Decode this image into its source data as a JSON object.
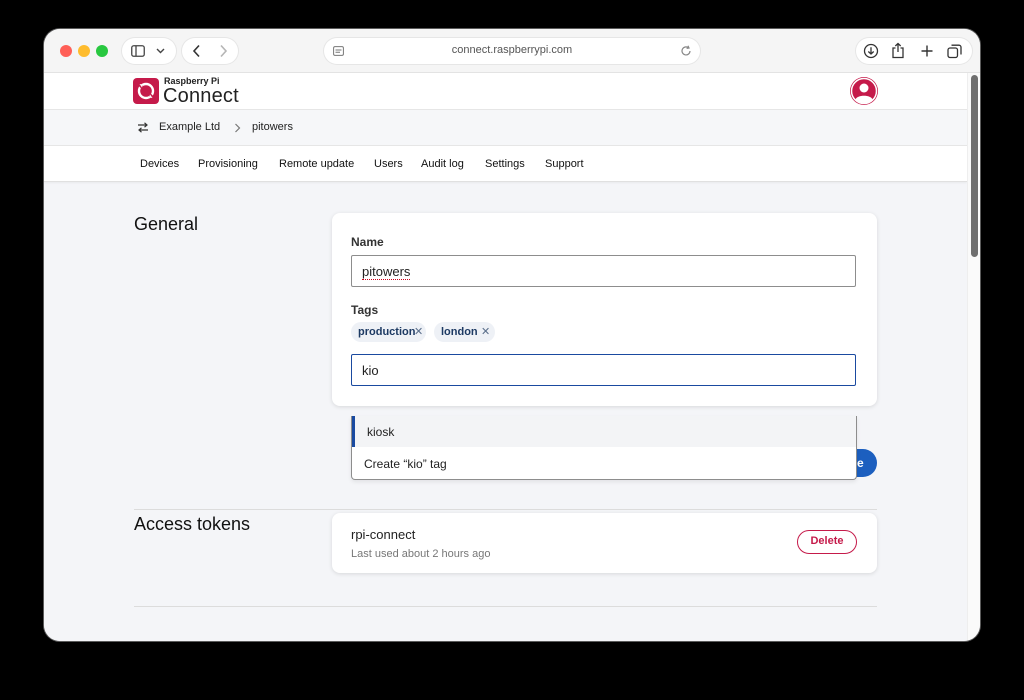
{
  "browser": {
    "url": "connect.raspberrypi.com"
  },
  "app": {
    "logo_small": "Raspberry Pi",
    "logo_big": "Connect"
  },
  "breadcrumb": {
    "org": "Example Ltd",
    "device": "pitowers"
  },
  "tabs": [
    {
      "label": "Devices"
    },
    {
      "label": "Provisioning"
    },
    {
      "label": "Remote update"
    },
    {
      "label": "Users"
    },
    {
      "label": "Audit log"
    },
    {
      "label": "Settings"
    },
    {
      "label": "Support"
    }
  ],
  "general": {
    "title": "General",
    "name_label": "Name",
    "name_value": "pitowers",
    "tags_label": "Tags",
    "tags": [
      {
        "label": "production"
      },
      {
        "label": "london"
      }
    ],
    "tag_input_value": "kio",
    "suggestions": [
      {
        "label": "kiosk"
      },
      {
        "label": "Create “kio” tag"
      }
    ],
    "save_label_partial": "e"
  },
  "access_tokens": {
    "title": "Access tokens",
    "items": [
      {
        "name": "rpi-connect",
        "last_used": "Last used about 2 hours ago",
        "delete_label": "Delete"
      }
    ]
  },
  "colors": {
    "brand": "#c51a4a",
    "primary": "#1c5fbf",
    "active_option_border": "#1a4aa0"
  },
  "icons": {
    "sidebar": "sidebar-icon",
    "back": "chevron-left-icon",
    "forward": "chevron-right-icon",
    "reload": "reload-icon",
    "download": "download-icon",
    "share": "share-icon",
    "new_tab": "plus-icon",
    "tabs": "tabs-overview-icon",
    "switch_org": "swap-arrows-icon",
    "avatar": "user-avatar-icon"
  }
}
